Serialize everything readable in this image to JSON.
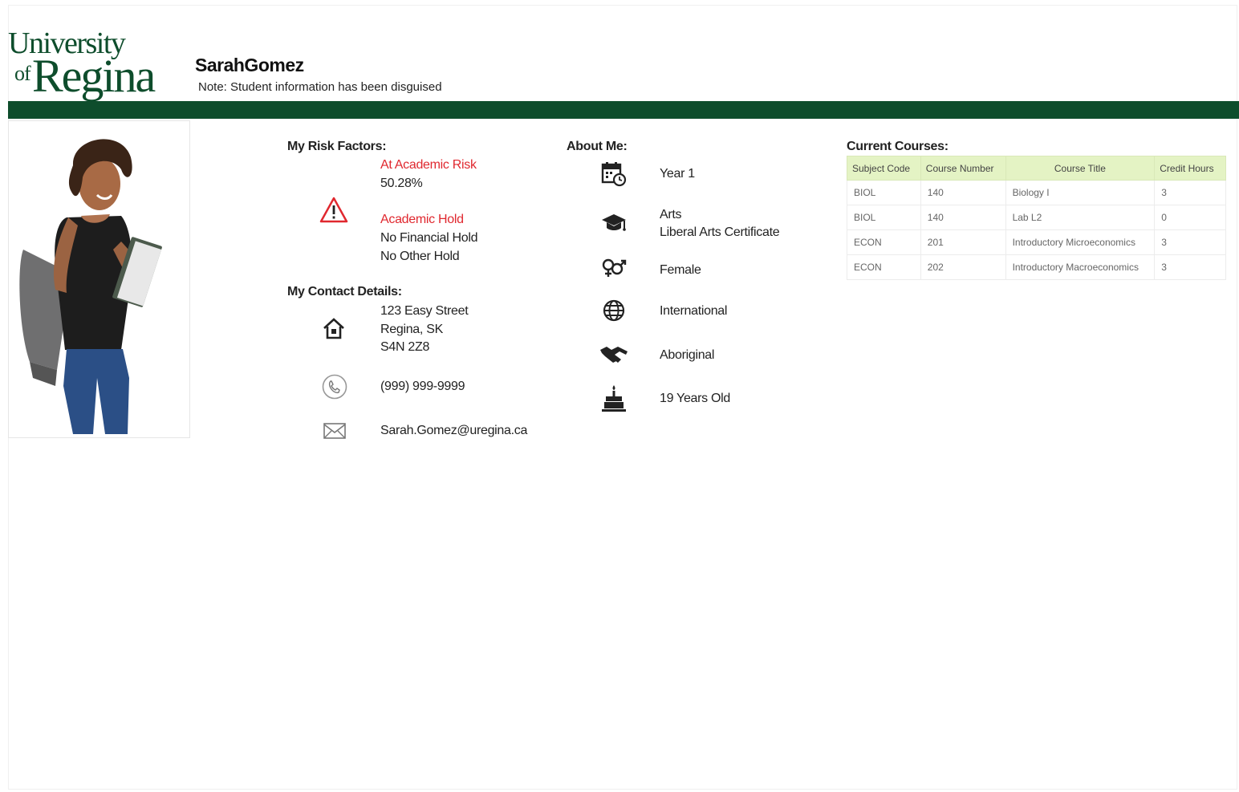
{
  "logo": {
    "line1": "University",
    "of": "of",
    "line2": "Regina"
  },
  "header": {
    "name": "SarahGomez",
    "note": "Note: Student information has been disguised"
  },
  "risk": {
    "title": "My Risk Factors:",
    "academic_risk": "At Academic Risk",
    "percent": "50.28%",
    "academic_hold": "Academic Hold",
    "financial_hold": "No Financial Hold",
    "other_hold": "No Other Hold"
  },
  "contact": {
    "title": "My Contact Details:",
    "address1": "123 Easy Street",
    "address2": "Regina, SK",
    "address3": "S4N 2Z8",
    "phone": "(999) 999-9999",
    "email": "Sarah.Gomez@uregina.ca"
  },
  "about": {
    "title": "About Me:",
    "year": "Year 1",
    "faculty": "Arts",
    "program": "Liberal Arts Certificate",
    "gender": "Female",
    "status": "International",
    "heritage": "Aboriginal",
    "age": "19 Years Old"
  },
  "courses": {
    "title": "Current Courses:",
    "headers": [
      "Subject Code",
      "Course Number",
      "Course Title",
      "Credit Hours"
    ],
    "rows": [
      [
        "BIOL",
        "140",
        "Biology I",
        "3"
      ],
      [
        "BIOL",
        "140",
        "Lab L2",
        "0"
      ],
      [
        "ECON",
        "201",
        "Introductory Microeconomics",
        "3"
      ],
      [
        "ECON",
        "202",
        "Introductory Macroeconomics",
        "3"
      ]
    ]
  },
  "colors": {
    "brand_green": "#0e4d2c",
    "alert_red": "#e0282f",
    "table_header": "#e4f3c4"
  },
  "icons": [
    "warning-icon",
    "home-icon",
    "phone-icon",
    "mail-icon",
    "calendar-icon",
    "graduation-cap-icon",
    "gender-icon",
    "globe-icon",
    "handshake-icon",
    "birthday-cake-icon"
  ]
}
